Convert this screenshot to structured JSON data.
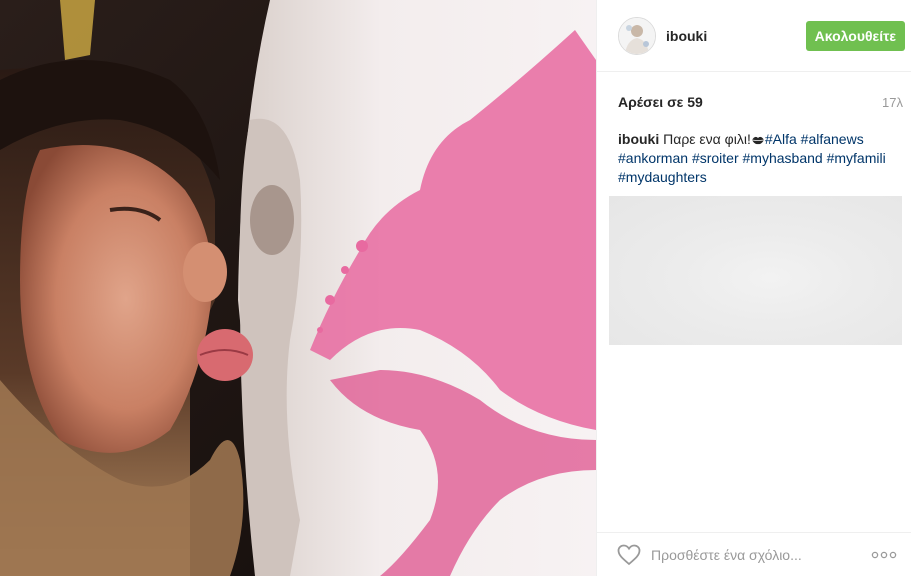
{
  "post": {
    "username": "ibouki",
    "follow_label": "Ακολουθείτε",
    "likes": "Αρέσει σε 59",
    "time": "17λ",
    "caption": {
      "text": "Παρε ενα φιλι!",
      "hashtags": [
        "#Alfa",
        "#alfanews",
        "#ankorman",
        "#sroiter",
        "#myhasband",
        "#myfamili",
        "#mydaughters"
      ]
    },
    "comment_placeholder": "Προσθέστε ένα σχόλιο...",
    "icons": {
      "avatar": "avatar-image",
      "lips": "lips-icon",
      "like": "heart-icon",
      "more": "more-options-icon"
    },
    "colors": {
      "follow_button": "#70c050",
      "hashtag": "#003569"
    }
  }
}
